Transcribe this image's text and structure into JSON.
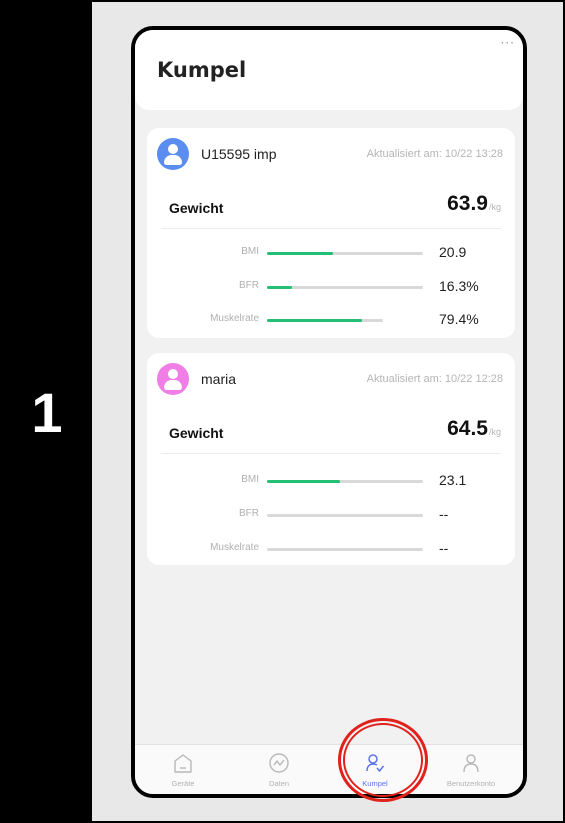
{
  "step": {
    "number": "1"
  },
  "app": {
    "title": "Kumpel",
    "more": "···"
  },
  "users": [
    {
      "name": "U15595 imp",
      "updated": "Aktualisiert am: 10/22 13:28",
      "avatar_color": "#5b8cf0",
      "weight_label": "Gewicht",
      "weight_value": "63.9",
      "weight_unit": "/kg",
      "metrics": [
        {
          "label": "BMI",
          "value": "20.9",
          "fill": 0.42
        },
        {
          "label": "BFR",
          "value": "16.3%",
          "fill": 0.16
        },
        {
          "label": "Muskelrate",
          "value": "79.4%",
          "fill": 0.82
        }
      ]
    },
    {
      "name": "maria",
      "updated": "Aktualisiert am: 10/22 12:28",
      "avatar_color": "#f07ee6",
      "weight_label": "Gewicht",
      "weight_value": "64.5",
      "weight_unit": "/kg",
      "metrics": [
        {
          "label": "BMI",
          "value": "23.1",
          "fill": 0.47
        },
        {
          "label": "BFR",
          "value": "--",
          "fill": 0
        },
        {
          "label": "Muskelrate",
          "value": "--",
          "fill": 0
        }
      ]
    }
  ],
  "tabs": [
    {
      "label": "Geräte",
      "icon": "home-icon",
      "active": false
    },
    {
      "label": "Daten",
      "icon": "chart-pulse-icon",
      "active": false
    },
    {
      "label": "Kumpel",
      "icon": "friends-icon",
      "active": true
    },
    {
      "label": "Benutzerkonto",
      "icon": "account-icon",
      "active": false
    }
  ],
  "colors": {
    "accent": "#5b73f0",
    "bar_fill": "#22bf75",
    "highlight": "#e1221c"
  }
}
